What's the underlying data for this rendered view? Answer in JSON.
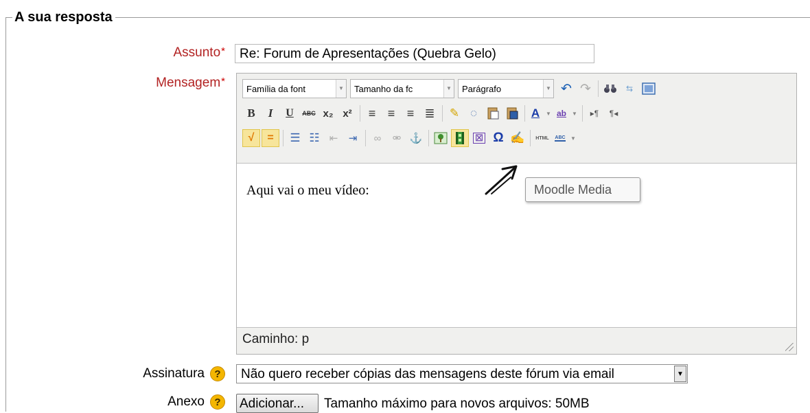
{
  "fieldset": {
    "legend": "A sua resposta"
  },
  "subject": {
    "label": "Assunto",
    "required_mark": "*",
    "value": "Re: Forum de Apresentações (Quebra Gelo)"
  },
  "message": {
    "label": "Mensagem",
    "required_mark": "*",
    "toolbar": {
      "font_family": "Família da font",
      "font_size": "Tamanho da fc",
      "format": "Parágrafo",
      "bold": "B",
      "italic": "I",
      "underline": "U",
      "strike": "ABC",
      "subscript": "x₂",
      "superscript": "x²",
      "color_letter": "A",
      "highlight_letter": "ab",
      "special_char": "Ω",
      "html_label": "HTML",
      "spell_label": "ABC"
    },
    "content": "Aqui vai o meu vídeo:",
    "path": "Caminho: p",
    "tooltip": "Moodle Media"
  },
  "signature": {
    "label": "Assinatura",
    "help": "?",
    "selected": "Não quero receber cópias das mensagens deste fórum via email"
  },
  "attachment": {
    "label": "Anexo",
    "help": "?",
    "button": "Adicionar...",
    "max_size": "Tamanho máximo para novos arquivos: 50MB"
  },
  "colors": {
    "required": "#b22222",
    "help": "#f4b600",
    "highlight": "#f7e59b"
  }
}
